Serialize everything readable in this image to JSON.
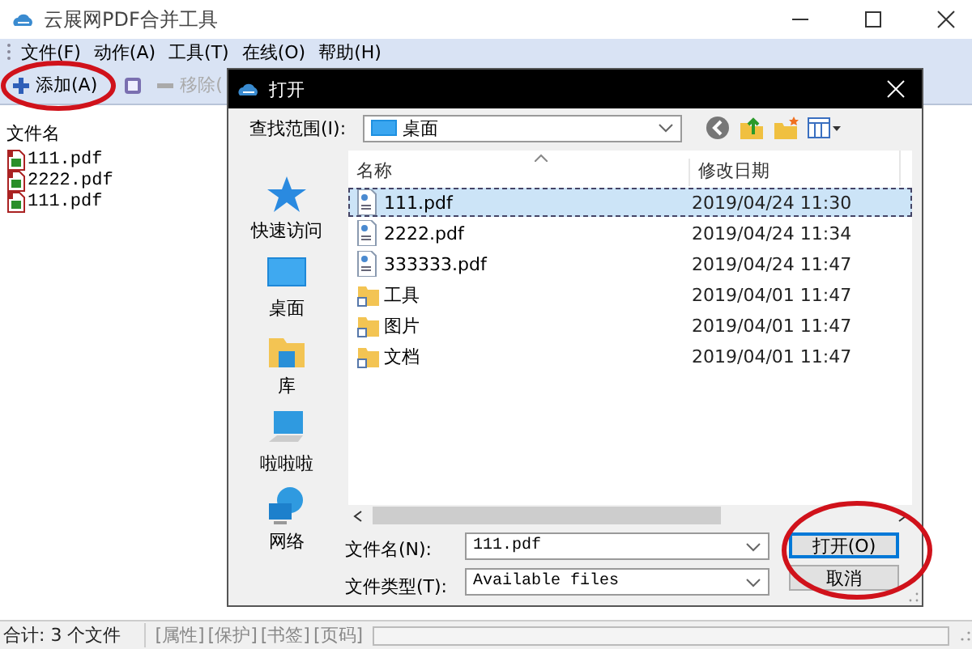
{
  "window": {
    "title": "云展网PDF合并工具"
  },
  "menu": [
    "文件(F)",
    "动作(A)",
    "工具(T)",
    "在线(O)",
    "帮助(H)"
  ],
  "toolbar": [
    {
      "kind": "add",
      "label": "添加(A)",
      "disabled": false
    },
    {
      "kind": "stop",
      "disabled": false
    },
    {
      "kind": "remove",
      "label": "移除(",
      "disabled": true
    }
  ],
  "file_list": {
    "column": "文件名",
    "rows": [
      "111.pdf",
      "2222.pdf",
      "111.pdf"
    ]
  },
  "status_bar": {
    "summary": "合计: 3 个文件",
    "tags": [
      "[属性]",
      "[保护]",
      "[书签]",
      "[页码]"
    ]
  },
  "dialog": {
    "title": "打开",
    "look_in": {
      "label": "查找范围(I):",
      "value": "桌面"
    },
    "places": [
      {
        "kind": "star",
        "label": "快速访问"
      },
      {
        "kind": "desktop",
        "label": "桌面"
      },
      {
        "kind": "library",
        "label": "库"
      },
      {
        "kind": "computer",
        "label": "啦啦啦"
      },
      {
        "kind": "network",
        "label": "网络"
      }
    ],
    "columns": [
      "名称",
      "修改日期"
    ],
    "files": [
      {
        "kind": "pdf",
        "name": "111.pdf",
        "modified": "2019/04/24 11:30",
        "selected": true
      },
      {
        "kind": "pdf",
        "name": "2222.pdf",
        "modified": "2019/04/24 11:34",
        "selected": false
      },
      {
        "kind": "pdf",
        "name": "333333.pdf",
        "modified": "2019/04/24 11:47",
        "selected": false
      },
      {
        "kind": "folder",
        "name": "工具",
        "modified": "2019/04/01 11:47",
        "selected": false
      },
      {
        "kind": "folder",
        "name": "图片",
        "modified": "2019/04/01 11:47",
        "selected": false
      },
      {
        "kind": "folder",
        "name": "文档",
        "modified": "2019/04/01 11:47",
        "selected": false
      }
    ],
    "file_name": {
      "label": "文件名(N):",
      "value": "111.pdf"
    },
    "file_type": {
      "label": "文件类型(T):",
      "value": "Available files"
    },
    "buttons": [
      {
        "kind": "open",
        "label": "打开(O)"
      },
      {
        "kind": "cancel",
        "label": "取消"
      }
    ]
  }
}
